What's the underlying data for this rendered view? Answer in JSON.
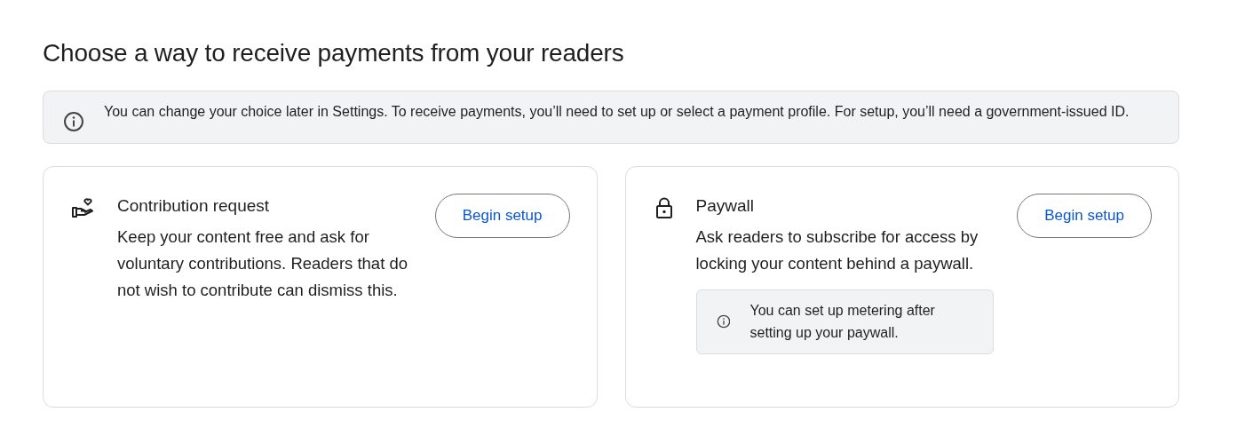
{
  "title": "Choose a way to receive payments from your readers",
  "banner": {
    "text": "You can change your choice later in Settings. To receive payments, you’ll need to set up or select a payment profile. For setup, you’ll need a government-issued ID."
  },
  "options": [
    {
      "kind": "contribution",
      "title": "Contribution request",
      "description": "Keep your content free and ask for voluntary contributions. Readers that do not wish to contribute can dismiss this.",
      "button": "Begin setup"
    },
    {
      "kind": "paywall",
      "title": "Paywall",
      "description": "Ask readers to subscribe for access by locking your content behind a paywall.",
      "note": "You can set up metering after setting up your paywall.",
      "button": "Begin setup"
    }
  ]
}
